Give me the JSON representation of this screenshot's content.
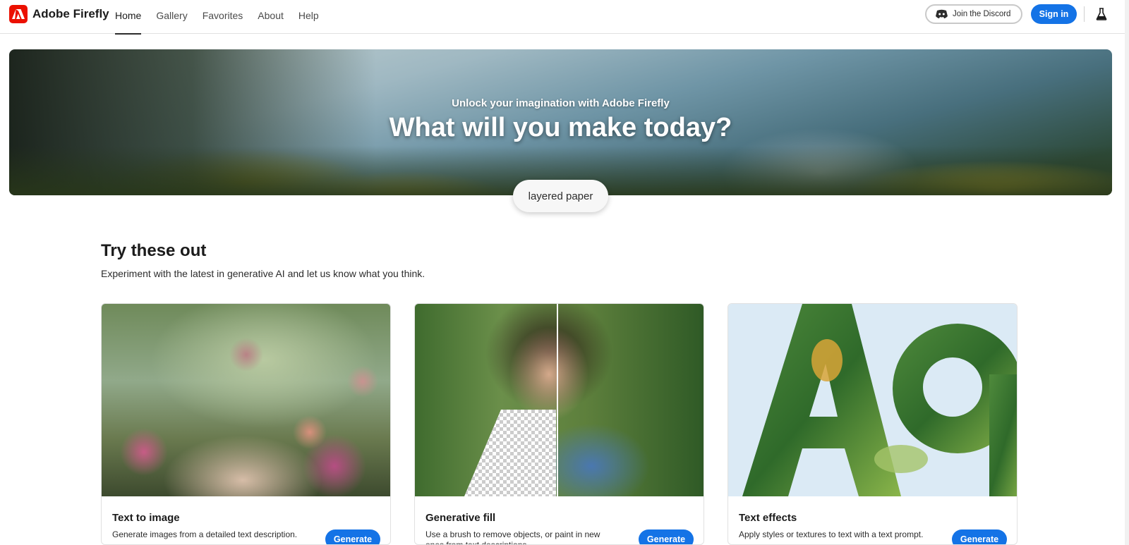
{
  "app": {
    "name": "Adobe Firefly"
  },
  "nav": {
    "items": [
      {
        "label": "Home",
        "active": true
      },
      {
        "label": "Gallery"
      },
      {
        "label": "Favorites"
      },
      {
        "label": "About"
      },
      {
        "label": "Help"
      }
    ]
  },
  "header": {
    "discord_label": "Join the Discord",
    "signin_label": "Sign in",
    "icons": [
      "adobe-logo-icon",
      "discord-icon",
      "labs-flask-icon"
    ]
  },
  "hero": {
    "subtitle": "Unlock your imagination with Adobe Firefly",
    "title": "What will you make today?",
    "prompt_chip": "layered paper"
  },
  "section": {
    "title": "Try these out",
    "description": "Experiment with the latest in generative AI and let us know what you think."
  },
  "cards": [
    {
      "title": "Text to image",
      "description": "Generate images from a detailed text description.",
      "button": "Generate"
    },
    {
      "title": "Generative fill",
      "description": "Use a brush to remove objects, or paint in new ones from text descriptions.",
      "button": "Generate"
    },
    {
      "title": "Text effects",
      "description": "Apply styles or textures to text with a text prompt.",
      "button": "Generate"
    }
  ],
  "colors": {
    "accent": "#1473e6",
    "brand": "#eb1000"
  }
}
